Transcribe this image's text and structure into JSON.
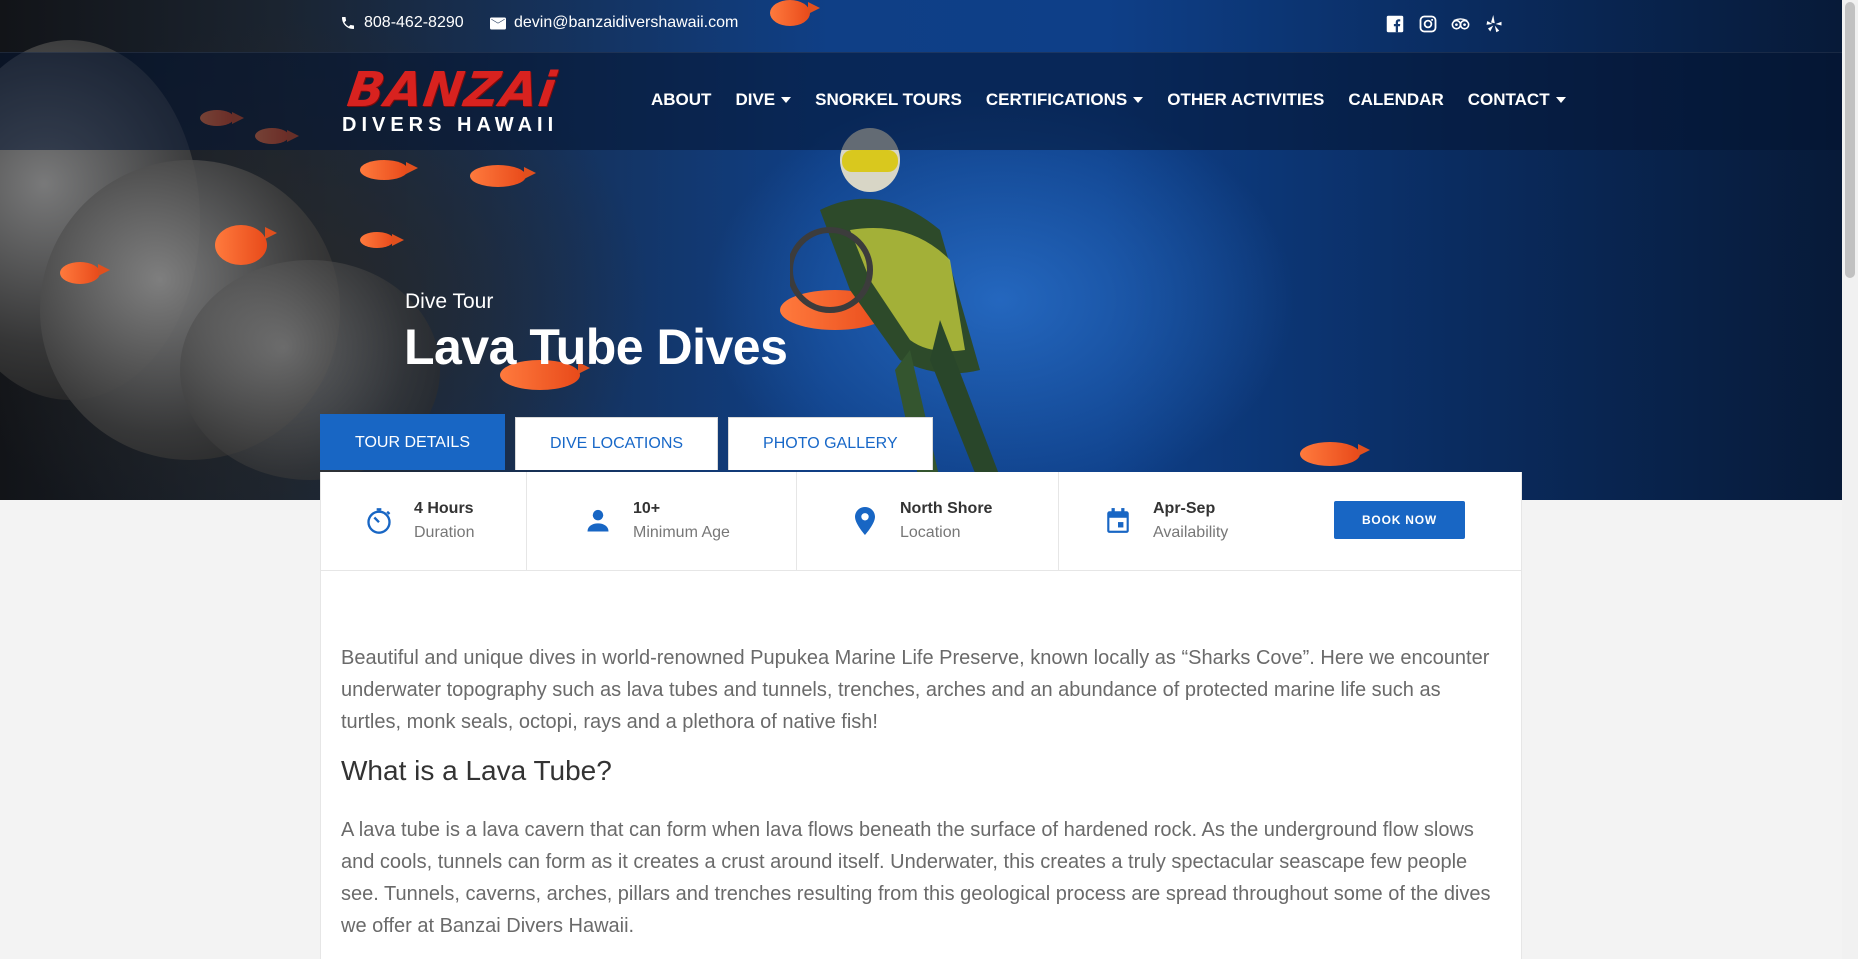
{
  "topbar": {
    "phone": "808-462-8290",
    "email": "devin@banzaidivershawaii.com",
    "social": [
      "facebook-icon",
      "instagram-icon",
      "tripadvisor-icon",
      "yelp-icon"
    ]
  },
  "logo": {
    "top": "BANZAi",
    "bottom": "DIVERS HAWAII"
  },
  "nav": {
    "items": [
      {
        "label": "ABOUT",
        "dropdown": false
      },
      {
        "label": "DIVE",
        "dropdown": true
      },
      {
        "label": "SNORKEL TOURS",
        "dropdown": false
      },
      {
        "label": "CERTIFICATIONS",
        "dropdown": true
      },
      {
        "label": "OTHER ACTIVITIES",
        "dropdown": false
      },
      {
        "label": "CALENDAR",
        "dropdown": false
      },
      {
        "label": "CONTACT",
        "dropdown": true
      }
    ]
  },
  "hero": {
    "subtitle": "Dive Tour",
    "title": "Lava Tube Dives"
  },
  "tabs": [
    {
      "label": "TOUR DETAILS",
      "active": true
    },
    {
      "label": "DIVE LOCATIONS",
      "active": false
    },
    {
      "label": "PHOTO GALLERY",
      "active": false
    }
  ],
  "info": [
    {
      "value": "4 Hours",
      "label": "Duration",
      "icon": "timer-icon"
    },
    {
      "value": "10+",
      "label": "Minimum Age",
      "icon": "person-icon"
    },
    {
      "value": "North Shore",
      "label": "Location",
      "icon": "map-pin-icon"
    },
    {
      "value": "Apr-Sep",
      "label": "Availability",
      "icon": "calendar-icon"
    }
  ],
  "book_label": "BOOK NOW",
  "content": {
    "intro": "Beautiful and unique dives in world-renowned Pupukea Marine Life Preserve, known locally as “Sharks Cove”. Here we encounter underwater topography such as lava tubes and tunnels, trenches, arches and an abundance of protected marine life such as turtles, monk seals, octopi, rays and a plethora of native fish!",
    "heading": "What is a Lava Tube?",
    "paragraph": "A lava tube is a lava cavern that can form when lava flows beneath the surface of hardened rock. As the underground flow slows and cools, tunnels can form as it creates a crust around itself. Underwater, this creates a truly spectacular seascape few people see. Tunnels, caverns, arches, pillars and trenches resulting from this geological process are spread throughout some of the dives we offer at Banzai Divers Hawaii."
  },
  "colors": {
    "accent": "#1866c4",
    "logo_red": "#d8221f"
  }
}
